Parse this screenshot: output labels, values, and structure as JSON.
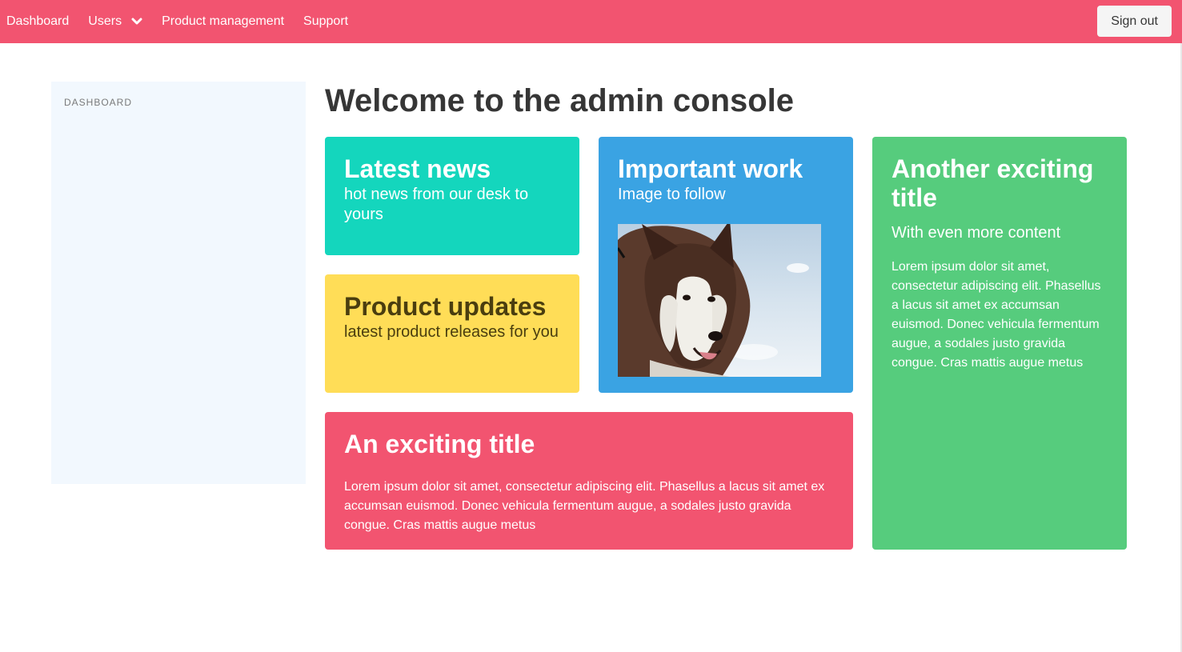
{
  "nav": {
    "items": [
      {
        "label": "Dashboard"
      },
      {
        "label": "Users"
      },
      {
        "label": "Product management"
      },
      {
        "label": "Support"
      }
    ],
    "signout_label": "Sign out"
  },
  "sidebar": {
    "label": "DASHBOARD"
  },
  "main": {
    "title": "Welcome to the admin console",
    "tiles": {
      "news": {
        "title": "Latest news",
        "subtitle": "hot news from our desk to yours"
      },
      "product": {
        "title": "Product updates",
        "subtitle": "latest product releases for you"
      },
      "work": {
        "title": "Important work",
        "subtitle": "Image to follow"
      },
      "exciting": {
        "title": "An exciting title",
        "body": "Lorem ipsum dolor sit amet, consectetur adipiscing elit. Phasellus a lacus sit amet ex accumsan euismod. Donec vehicula fermentum augue, a sodales justo gravida congue. Cras mattis augue metus"
      },
      "another": {
        "title": "Another exciting title",
        "subtitle": "With even more content",
        "body": "Lorem ipsum dolor sit amet, consectetur adipiscing elit. Phasellus a lacus sit amet ex accumsan euismod. Donec vehicula fermentum augue, a sodales justo gravida congue. Cras mattis augue metus"
      }
    }
  },
  "colors": {
    "navbar": "#f25470",
    "news": "#14d6bd",
    "product": "#ffdd57",
    "work": "#3aa3e3",
    "exciting": "#f25470",
    "another": "#56cc7d",
    "sidebar_bg": "#f2f8fe"
  },
  "icons": {
    "users_dropdown": "chevron-down-icon",
    "work_image": "husky-dog-photo"
  }
}
